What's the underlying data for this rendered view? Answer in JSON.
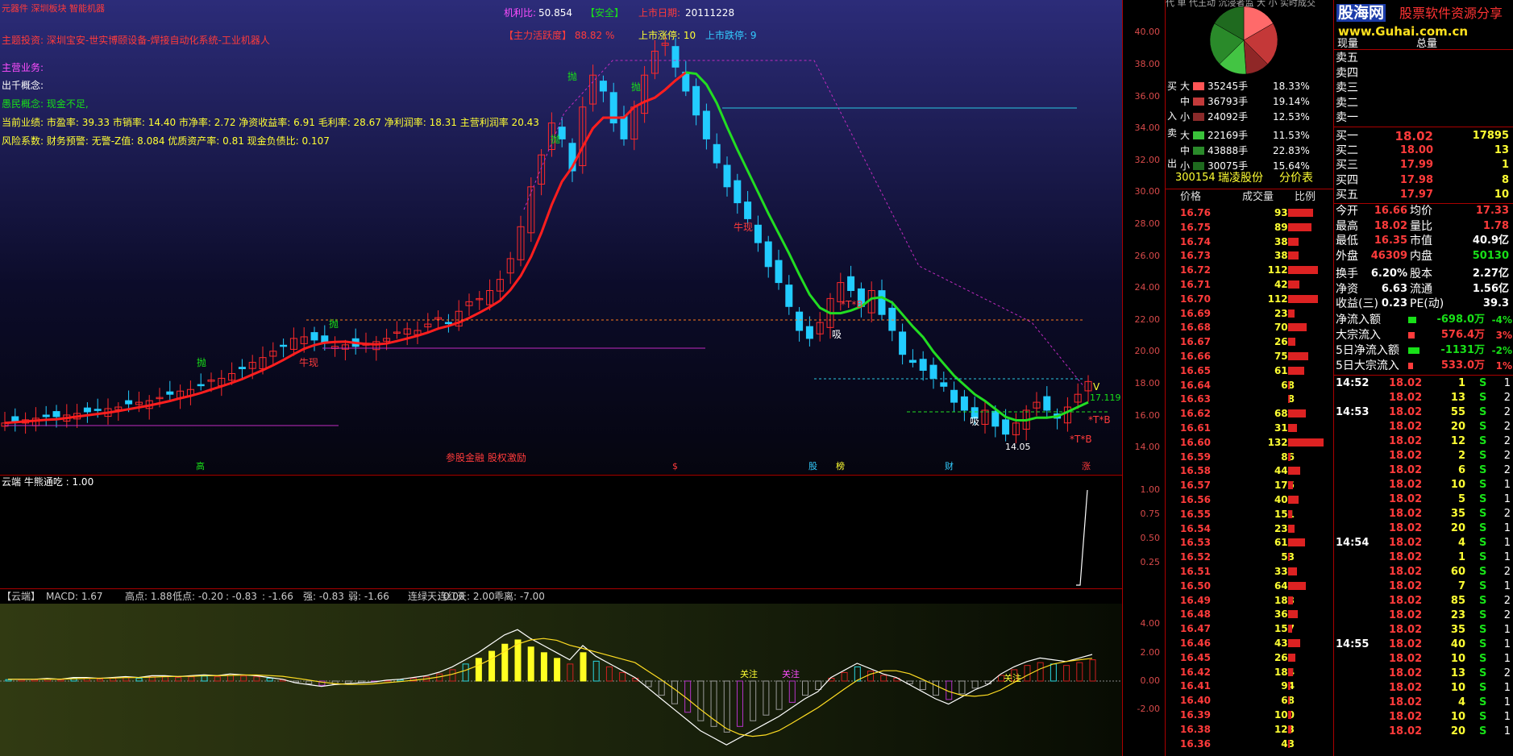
{
  "main": {
    "top_fragments": [
      "元器件 深圳板块 智能机器",
      "机利比:",
      "50.854",
      "【安全】",
      "上市日期:",
      "20111228"
    ],
    "info_lines": [
      "主题投资: 深圳宝安-世实博颐设备-焊接自动化系统-工业机器人",
      "主营业务:",
      "出千概念:",
      "愚民概念: 现金不足,",
      "当前业绩: 市盈率: 39.33 市销率: 14.40 市净率: 2.72 净资收益率: 6.91 毛利率: 28.67 净利润率: 18.31 主营利润率 20.43",
      "风险系数: 财务预警: 无警-Z值: 8.084 优质资产率: 0.81 现金负债比: 0.107"
    ],
    "main_force": "【主力活跃度】 88.82 %",
    "limit_up": "上市涨停: 10",
    "limit_down": "上市跌停: 9",
    "annotations": {
      "pao1": "抛",
      "pao2": "抛",
      "pao3": "抛",
      "pao4": "抛",
      "pao5": "抛",
      "niu_xian": "牛现",
      "xi1": "吸",
      "xi2": "吸",
      "tb1": "*T*B",
      "tb2": "*T*B",
      "tb3": "*T*B",
      "price_low": "14.05",
      "price_now": "17.119",
      "v_mark": "V",
      "niu_bian": "牛现",
      "bottom_note": "参股金融 股权激励",
      "event_marks": [
        "高",
        "$",
        "股",
        "榜",
        "财",
        "涨"
      ]
    },
    "price_axis": [
      "40.00",
      "38.00",
      "36.00",
      "34.00",
      "32.00",
      "30.00",
      "28.00",
      "26.00",
      "24.00",
      "22.00",
      "20.00",
      "18.00",
      "16.00",
      "14.00"
    ]
  },
  "sub": {
    "title": "云端 牛熊通吃 : 1.00",
    "axis": [
      "1.00",
      "0.75",
      "0.50",
      "0.25"
    ]
  },
  "macd": {
    "header": [
      {
        "text": "【云端】",
        "color": "#ffffff"
      },
      {
        "text": "MACD: 1.67",
        "color": "#ffff33"
      },
      {
        "text": "高点: 1.88",
        "color": "#18e018"
      },
      {
        "text": "低点: -0.20",
        "color": "#18e018"
      },
      {
        "text": ": -0.83",
        "color": "#ffffff"
      },
      {
        "text": ": -1.66",
        "color": "#3cf"
      },
      {
        "text": "强: -0.83",
        "color": "#ff3b3b"
      },
      {
        "text": "弱: -1.66",
        "color": "#ffffff"
      },
      {
        "text": "连绿天: 0.00",
        "color": "#18e018"
      },
      {
        "text": "连红天: 2.00",
        "color": "#ff3b3b"
      },
      {
        "text": "乖离: -7.00",
        "color": "#18e018"
      }
    ],
    "labels": [
      "关注",
      "关注",
      "关注"
    ],
    "axis": [
      "4.00",
      "2.00",
      "0.00",
      "-2.00"
    ]
  },
  "order_book": {
    "top_tabs": "代 单 代王动 沉浸者监 大 小 实时成交",
    "pie_labels": [
      "买",
      "入",
      "卖",
      "出"
    ],
    "flows": [
      {
        "side": "大",
        "color": "#ff5555",
        "vol": "35245手",
        "pct": "18.33%"
      },
      {
        "side": "中",
        "color": "#c23a3a",
        "vol": "36793手",
        "pct": "19.14%"
      },
      {
        "side": "小",
        "color": "#8a2a2a",
        "vol": "24092手",
        "pct": "12.53%"
      },
      {
        "side": "大",
        "color": "#3ac23a",
        "vol": "22169手",
        "pct": "11.53%"
      },
      {
        "side": "中",
        "color": "#2a8a2a",
        "vol": "43888手",
        "pct": "22.83%"
      },
      {
        "side": "小",
        "color": "#1e6a1e",
        "vol": "30075手",
        "pct": "15.64%"
      }
    ],
    "stock_code": "300154",
    "stock_name": "瑞凌股份",
    "price_table_title": "分价表",
    "columns": [
      "价格",
      "成交量",
      "比例"
    ],
    "rows": [
      {
        "price": "16.76",
        "vol": "935",
        "bar": 0.7
      },
      {
        "price": "16.75",
        "vol": "890",
        "bar": 0.67
      },
      {
        "price": "16.74",
        "vol": "389",
        "bar": 0.29
      },
      {
        "price": "16.73",
        "vol": "385",
        "bar": 0.29
      },
      {
        "price": "16.72",
        "vol": "1120",
        "bar": 0.84
      },
      {
        "price": "16.71",
        "vol": "422",
        "bar": 0.32
      },
      {
        "price": "16.70",
        "vol": "1125",
        "bar": 0.85
      },
      {
        "price": "16.69",
        "vol": "234",
        "bar": 0.18
      },
      {
        "price": "16.68",
        "vol": "705",
        "bar": 0.53
      },
      {
        "price": "16.67",
        "vol": "265",
        "bar": 0.2
      },
      {
        "price": "16.66",
        "vol": "751",
        "bar": 0.57
      },
      {
        "price": "16.65",
        "vol": "612",
        "bar": 0.46
      },
      {
        "price": "16.64",
        "vol": "68",
        "bar": 0.05
      },
      {
        "price": "16.63",
        "vol": "8",
        "bar": 0.01
      },
      {
        "price": "16.62",
        "vol": "684",
        "bar": 0.51
      },
      {
        "price": "16.61",
        "vol": "313",
        "bar": 0.24
      },
      {
        "price": "16.60",
        "vol": "1328",
        "bar": 1.0
      },
      {
        "price": "16.59",
        "vol": "86",
        "bar": 0.06
      },
      {
        "price": "16.58",
        "vol": "444",
        "bar": 0.33
      },
      {
        "price": "16.57",
        "vol": "175",
        "bar": 0.13
      },
      {
        "price": "16.56",
        "vol": "402",
        "bar": 0.3
      },
      {
        "price": "16.55",
        "vol": "151",
        "bar": 0.11
      },
      {
        "price": "16.54",
        "vol": "236",
        "bar": 0.18
      },
      {
        "price": "16.53",
        "vol": "618",
        "bar": 0.47
      },
      {
        "price": "16.52",
        "vol": "53",
        "bar": 0.04
      },
      {
        "price": "16.51",
        "vol": "339",
        "bar": 0.26
      },
      {
        "price": "16.50",
        "vol": "649",
        "bar": 0.49
      },
      {
        "price": "16.49",
        "vol": "183",
        "bar": 0.14
      },
      {
        "price": "16.48",
        "vol": "366",
        "bar": 0.28
      },
      {
        "price": "16.47",
        "vol": "157",
        "bar": 0.12
      },
      {
        "price": "16.46",
        "vol": "433",
        "bar": 0.33
      },
      {
        "price": "16.45",
        "vol": "263",
        "bar": 0.2
      },
      {
        "price": "16.42",
        "vol": "184",
        "bar": 0.14
      },
      {
        "price": "16.41",
        "vol": "94",
        "bar": 0.07
      },
      {
        "price": "16.40",
        "vol": "68",
        "bar": 0.05
      },
      {
        "price": "16.39",
        "vol": "100",
        "bar": 0.08
      },
      {
        "price": "16.38",
        "vol": "123",
        "bar": 0.09
      },
      {
        "price": "16.36",
        "vol": "43",
        "bar": 0.03
      }
    ]
  },
  "quote": {
    "site_title": "股海网",
    "site_subtitle": "股票软件资源分享",
    "site_url": "www.Guhai.com.cn",
    "partial_row": [
      "现量",
      "总量"
    ],
    "sells": [
      "卖五",
      "卖四",
      "卖三",
      "卖二",
      "卖一"
    ],
    "buys": [
      {
        "label": "买一",
        "price": "18.02",
        "vol": "17895"
      },
      {
        "label": "买二",
        "price": "18.00",
        "vol": "13"
      },
      {
        "label": "买三",
        "price": "17.99",
        "vol": "1"
      },
      {
        "label": "买四",
        "price": "17.98",
        "vol": "8"
      },
      {
        "label": "买五",
        "price": "17.97",
        "vol": "10"
      }
    ],
    "stats": [
      {
        "l1": "今开",
        "v1": "16.66",
        "c1": "#ff3b3b",
        "l2": "均价",
        "v2": "17.33",
        "c2": "#ff3b3b"
      },
      {
        "l1": "最高",
        "v1": "18.02",
        "c1": "#ff3b3b",
        "l2": "量比",
        "v2": "1.78",
        "c2": "#ff3b3b"
      },
      {
        "l1": "最低",
        "v1": "16.35",
        "c1": "#ff3b3b",
        "l2": "市值",
        "v2": "40.9亿",
        "c2": "#ffffff"
      },
      {
        "l1": "外盘",
        "v1": "46309",
        "c1": "#ff3b3b",
        "l2": "内盘",
        "v2": "50130",
        "c2": "#18e018"
      },
      {
        "l1": "换手",
        "v1": "6.20%",
        "c1": "#ffffff",
        "l2": "股本",
        "v2": "2.27亿",
        "c2": "#ffffff"
      },
      {
        "l1": "净资",
        "v1": "6.63",
        "c1": "#ffffff",
        "l2": "流通",
        "v2": "1.56亿",
        "c2": "#ffffff"
      },
      {
        "l1": "收益(三)",
        "v1": "0.23",
        "c1": "#ffffff",
        "l2": "PE(动)",
        "v2": "39.3",
        "c2": "#ffffff"
      }
    ],
    "flows": [
      {
        "label": "净流入额",
        "value": "-698.0万",
        "pct": "-4%",
        "color": "#18e018",
        "bar": 0.3
      },
      {
        "label": "大宗流入",
        "value": "576.4万",
        "pct": "3%",
        "color": "#ff3b3b",
        "bar": 0.25
      },
      {
        "label": "5日净流入额",
        "value": "-1131万",
        "pct": "-2%",
        "color": "#18e018",
        "bar": 0.45
      },
      {
        "label": "5日大宗流入",
        "value": "533.0万",
        "pct": "1%",
        "color": "#ff3b3b",
        "bar": 0.2
      }
    ],
    "ticks": [
      {
        "time": "14:52",
        "price": "18.02",
        "vol": "1",
        "bs": "S",
        "n": "1"
      },
      {
        "time": "",
        "price": "18.02",
        "vol": "13",
        "bs": "S",
        "n": "2"
      },
      {
        "time": "14:53",
        "price": "18.02",
        "vol": "55",
        "bs": "S",
        "n": "2"
      },
      {
        "time": "",
        "price": "18.02",
        "vol": "20",
        "bs": "S",
        "n": "2"
      },
      {
        "time": "",
        "price": "18.02",
        "vol": "12",
        "bs": "S",
        "n": "2"
      },
      {
        "time": "",
        "price": "18.02",
        "vol": "2",
        "bs": "S",
        "n": "2"
      },
      {
        "time": "",
        "price": "18.02",
        "vol": "6",
        "bs": "S",
        "n": "2"
      },
      {
        "time": "",
        "price": "18.02",
        "vol": "10",
        "bs": "S",
        "n": "1"
      },
      {
        "time": "",
        "price": "18.02",
        "vol": "5",
        "bs": "S",
        "n": "1"
      },
      {
        "time": "",
        "price": "18.02",
        "vol": "35",
        "bs": "S",
        "n": "2"
      },
      {
        "time": "",
        "price": "18.02",
        "vol": "20",
        "bs": "S",
        "n": "1"
      },
      {
        "time": "14:54",
        "price": "18.02",
        "vol": "4",
        "bs": "S",
        "n": "1"
      },
      {
        "time": "",
        "price": "18.02",
        "vol": "1",
        "bs": "S",
        "n": "1"
      },
      {
        "time": "",
        "price": "18.02",
        "vol": "60",
        "bs": "S",
        "n": "2"
      },
      {
        "time": "",
        "price": "18.02",
        "vol": "7",
        "bs": "S",
        "n": "1"
      },
      {
        "time": "",
        "price": "18.02",
        "vol": "85",
        "bs": "S",
        "n": "2"
      },
      {
        "time": "",
        "price": "18.02",
        "vol": "23",
        "bs": "S",
        "n": "2"
      },
      {
        "time": "",
        "price": "18.02",
        "vol": "35",
        "bs": "S",
        "n": "1"
      },
      {
        "time": "14:55",
        "price": "18.02",
        "vol": "40",
        "bs": "S",
        "n": "1"
      },
      {
        "time": "",
        "price": "18.02",
        "vol": "10",
        "bs": "S",
        "n": "1"
      },
      {
        "time": "",
        "price": "18.02",
        "vol": "13",
        "bs": "S",
        "n": "2"
      },
      {
        "time": "",
        "price": "18.02",
        "vol": "10",
        "bs": "S",
        "n": "1"
      },
      {
        "time": "",
        "price": "18.02",
        "vol": "4",
        "bs": "S",
        "n": "1"
      },
      {
        "time": "",
        "price": "18.02",
        "vol": "10",
        "bs": "S",
        "n": "1"
      },
      {
        "time": "",
        "price": "18.02",
        "vol": "20",
        "bs": "S",
        "n": "1"
      }
    ]
  },
  "colors": {
    "up": "#ff2a2a",
    "down": "#22ccff",
    "ma_up": "#ff1e1e",
    "ma_down": "#22dd22"
  }
}
